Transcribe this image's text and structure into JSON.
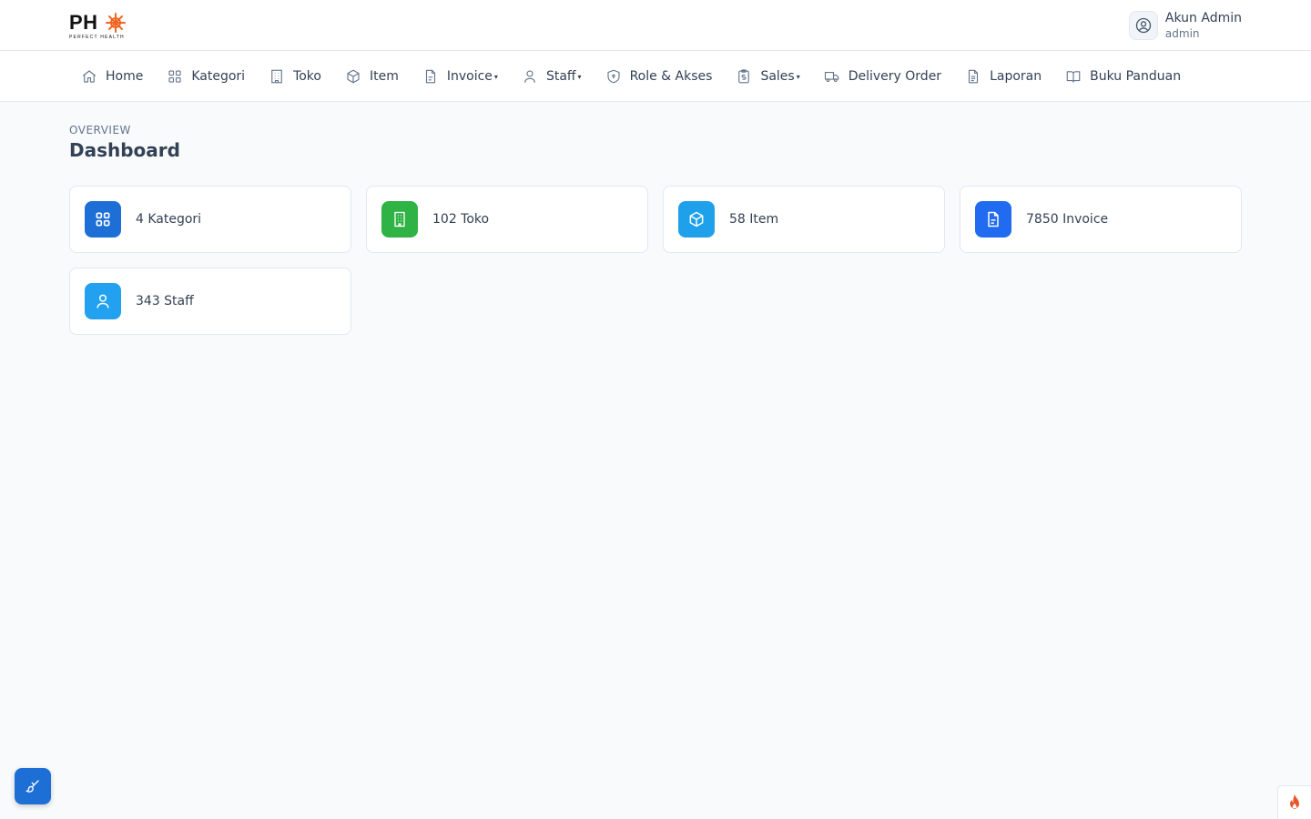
{
  "app": {
    "logo_text": "PH",
    "logo_subtitle": "PERFECT HEALTH"
  },
  "user": {
    "name": "Akun Admin",
    "role": "admin"
  },
  "nav": {
    "items": [
      {
        "label": "Home",
        "icon": "home-icon"
      },
      {
        "label": "Kategori",
        "icon": "grid-icon"
      },
      {
        "label": "Toko",
        "icon": "building-icon"
      },
      {
        "label": "Item",
        "icon": "box-icon"
      },
      {
        "label": "Invoice",
        "icon": "file-icon",
        "dropdown": true
      },
      {
        "label": "Staff",
        "icon": "user-icon",
        "dropdown": true
      },
      {
        "label": "Role & Akses",
        "icon": "shield-icon"
      },
      {
        "label": "Sales",
        "icon": "clipboard-dollar-icon",
        "dropdown": true
      },
      {
        "label": "Delivery Order",
        "icon": "truck-icon"
      },
      {
        "label": "Laporan",
        "icon": "document-icon"
      },
      {
        "label": "Buku Panduan",
        "icon": "book-icon"
      }
    ]
  },
  "header": {
    "eyebrow": "OVERVIEW",
    "title": "Dashboard"
  },
  "stats": [
    {
      "label": "4 Kategori",
      "icon": "grid-icon",
      "color": "#1d6fd6"
    },
    {
      "label": "102 Toko",
      "icon": "building-icon",
      "color": "#2fb344"
    },
    {
      "label": "58 Item",
      "icon": "box-icon",
      "color": "#1ea0ea"
    },
    {
      "label": "7850 Invoice",
      "icon": "file-icon",
      "color": "#206bf0"
    },
    {
      "label": "343 Staff",
      "icon": "user-icon",
      "color": "#21a1f0"
    }
  ],
  "colors": {
    "logo_accent": "#f26522",
    "float_button": "#1d6fd6",
    "flame": "#e8562a"
  }
}
